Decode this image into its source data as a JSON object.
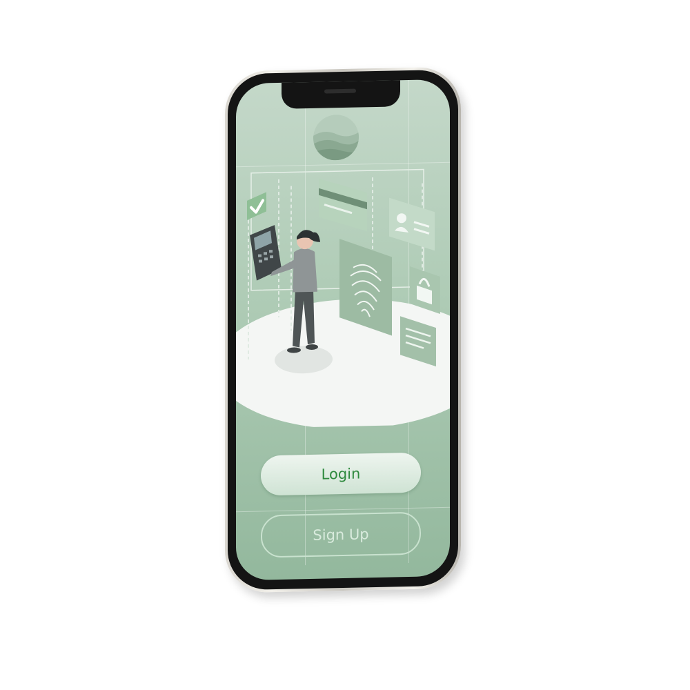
{
  "login_screen": {
    "login_label": "Login",
    "signup_label": "Sign Up"
  },
  "icons": {
    "logo": "hills-logo-icon",
    "checkmark": "checkmark-icon",
    "credit_card": "credit-card-icon",
    "id_card": "id-card-icon",
    "fingerprint": "fingerprint-icon",
    "padlock": "padlock-icon",
    "document": "document-icon",
    "terminal": "payment-terminal-icon"
  },
  "colors": {
    "screen_top": "#c4d8c9",
    "screen_bottom": "#93b89d",
    "login_text": "#2f8a3e",
    "signup_border": "#c9e2cf"
  }
}
